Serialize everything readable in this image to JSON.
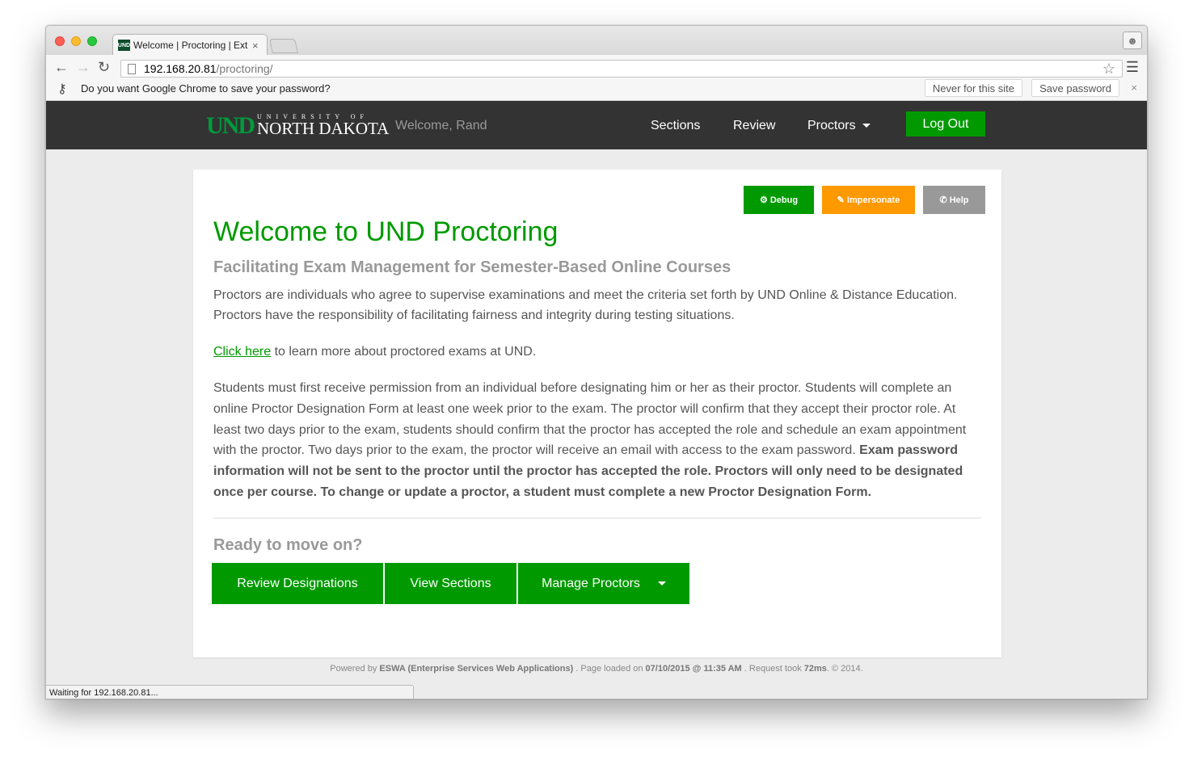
{
  "browser": {
    "tab_title": "Welcome | Proctoring | Ext",
    "tab_close": "×",
    "favicon_text": "UND",
    "url_host": "192.168.20.81",
    "url_path": "/proctoring/",
    "infobar": {
      "message": "Do you want Google Chrome to save your password?",
      "never_label": "Never for this site",
      "save_label": "Save password",
      "close": "×"
    },
    "status_text": "Waiting for 192.168.20.81..."
  },
  "site": {
    "logo_mark": "UND",
    "logo_univ": "UNIVERSITY OF",
    "logo_name": "NORTH DAKOTA",
    "welcome": "Welcome, Rand",
    "nav": {
      "sections": "Sections",
      "review": "Review",
      "proctors": "Proctors",
      "logout": "Log Out"
    }
  },
  "tools": {
    "debug": "Debug",
    "impersonate": "Impersonate",
    "help": "Help"
  },
  "content": {
    "title": "Welcome to UND Proctoring",
    "subtitle": "Facilitating Exam Management for Semester-Based Online Courses",
    "intro": "Proctors are individuals who agree to supervise examinations and meet the criteria set forth by UND Online & Distance Education. Proctors have the responsibility of facilitating fairness and integrity during testing situations.",
    "link_text": "Click here",
    "link_rest": " to learn more about proctored exams at UND.",
    "body_normal": "Students must first receive permission from an individual before designating him or her as their proctor. Students will complete an online Proctor Designation Form at least one week prior to the exam. The proctor will confirm that they accept their proctor role. At least two days prior to the exam, students should confirm that the proctor has accepted the role and schedule an exam appointment with the proctor. Two days prior to the exam, the proctor will receive an email with access to the exam password. ",
    "body_bold": "Exam password information will not be sent to the proctor until the proctor has accepted the role. Proctors will only need to be designated once per course. To change or update a proctor, a student must complete a new Proctor Designation Form.",
    "ready": "Ready to move on?",
    "actions": {
      "review": "Review Designations",
      "sections": "View Sections",
      "manage": "Manage Proctors"
    }
  },
  "footer": {
    "powered": "Powered by ",
    "eswa": "ESWA (Enterprise Services Web Applications)",
    "loaded": " . Page loaded on ",
    "date": "07/10/2015 @ 11:35 AM",
    "took": " . Request took ",
    "ms": "72ms",
    "copy": ". © 2014."
  },
  "colors": {
    "brand_green": "#009a00",
    "impersonate_orange": "#ff9900",
    "help_gray": "#999999",
    "nav_dark": "#333333"
  }
}
